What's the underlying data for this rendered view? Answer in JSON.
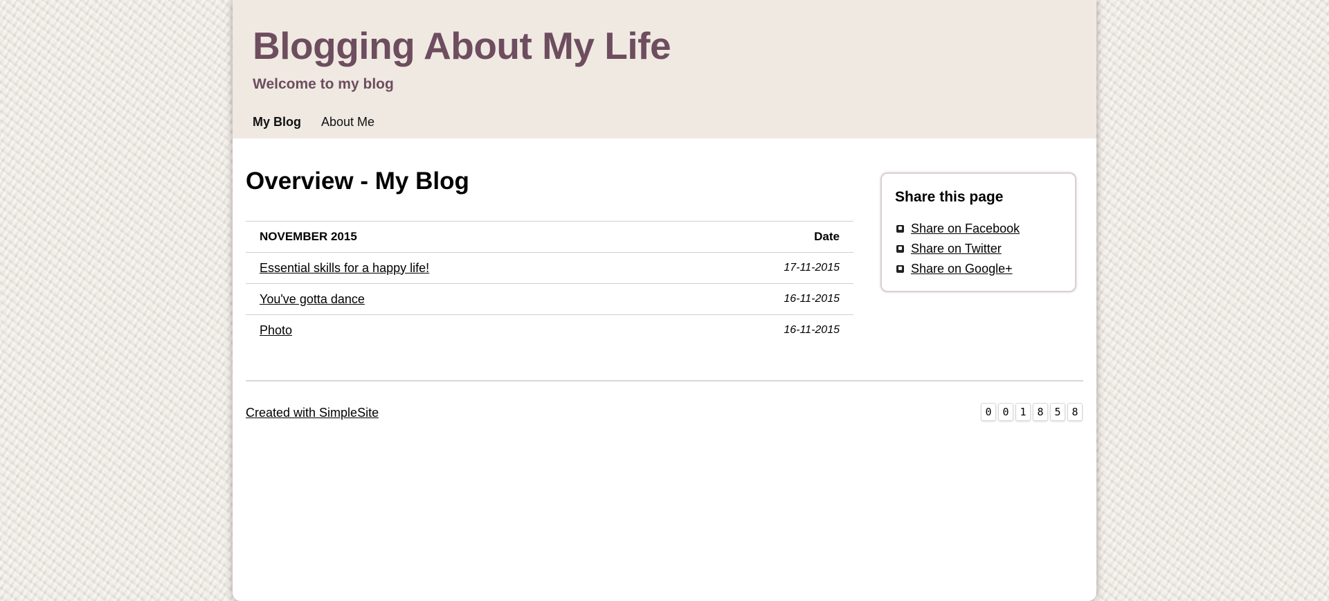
{
  "header": {
    "title": "Blogging About My Life",
    "subtitle": "Welcome to my blog",
    "nav": [
      {
        "label": "My Blog",
        "active": true
      },
      {
        "label": "About Me",
        "active": false
      }
    ]
  },
  "main": {
    "title": "Overview - My Blog",
    "table": {
      "month_header": "NOVEMBER 2015",
      "date_header": "Date",
      "rows": [
        {
          "title": "Essential skills for a happy life!",
          "date": "17-11-2015"
        },
        {
          "title": "You've gotta dance",
          "date": "16-11-2015"
        },
        {
          "title": "Photo",
          "date": "16-11-2015"
        }
      ]
    }
  },
  "sidebar": {
    "share_title": "Share this page",
    "links": [
      {
        "label": "Share on Facebook",
        "icon": "facebook-icon"
      },
      {
        "label": "Share on Twitter",
        "icon": "twitter-icon"
      },
      {
        "label": "Share on Google+",
        "icon": "google-plus-icon"
      }
    ]
  },
  "footer": {
    "credit": "Created with SimpleSite",
    "counter_digits": [
      "0",
      "0",
      "1",
      "8",
      "5",
      "8"
    ]
  },
  "colors": {
    "title": "#6d4d5e",
    "header_bg": "#efe9e2",
    "page_bg": "#ffffff",
    "body_bg": "#efebe2"
  }
}
